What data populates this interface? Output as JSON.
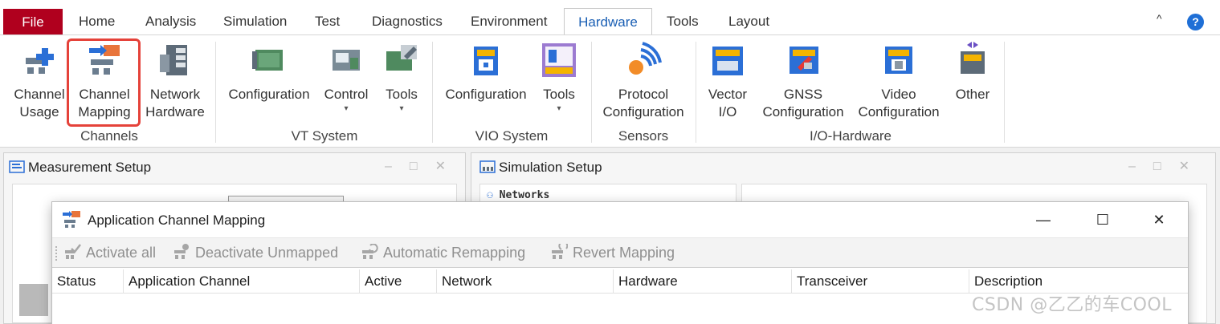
{
  "tabs": {
    "file": "File",
    "items": [
      "Home",
      "Analysis",
      "Simulation",
      "Test",
      "Diagnostics",
      "Environment",
      "Hardware",
      "Tools",
      "Layout"
    ],
    "active": "Hardware",
    "collapse": "^",
    "help": "?"
  },
  "ribbon": {
    "channel_usage": [
      "Channel",
      "Usage"
    ],
    "channel_mapping": [
      "Channel",
      "Mapping"
    ],
    "network_hardware": [
      "Network",
      "Hardware"
    ],
    "vt_configuration": "Configuration",
    "vt_control": "Control",
    "vt_tools": "Tools",
    "vio_configuration": "Configuration",
    "vio_tools": "Tools",
    "protocol_configuration": [
      "Protocol",
      "Configuration"
    ],
    "vector_io": [
      "Vector",
      "I/O"
    ],
    "gnss_configuration": [
      "GNSS",
      "Configuration"
    ],
    "video_configuration": [
      "Video",
      "Configuration"
    ],
    "other": "Other",
    "groups": {
      "channels": "Channels",
      "vt_system": "VT System",
      "vio_system": "VIO System",
      "sensors": "Sensors",
      "io_hardware": "I/O-Hardware"
    }
  },
  "panes": {
    "measurement_title": "Measurement Setup",
    "simulation_title": "Simulation Setup",
    "networks_label": "Networks",
    "window_controls": [
      "–",
      "□",
      "✕"
    ]
  },
  "dialog": {
    "title": "Application Channel Mapping",
    "controls": [
      "—",
      "☐",
      "✕"
    ],
    "toolbar": {
      "activate_all": "Activate all",
      "deactivate_unmapped": "Deactivate Unmapped",
      "automatic_remapping": "Automatic Remapping",
      "revert_mapping": "Revert Mapping"
    },
    "columns": [
      "Status",
      "Application Channel",
      "Active",
      "Network",
      "Hardware",
      "Transceiver",
      "Description"
    ]
  },
  "watermark": "CSDN @乙乙的车COOL",
  "colors": {
    "file_tab": "#b0001e",
    "active_tab_text": "#1a5fb4",
    "highlight_box": "#e5423a",
    "help_button": "#1f6fd6"
  }
}
